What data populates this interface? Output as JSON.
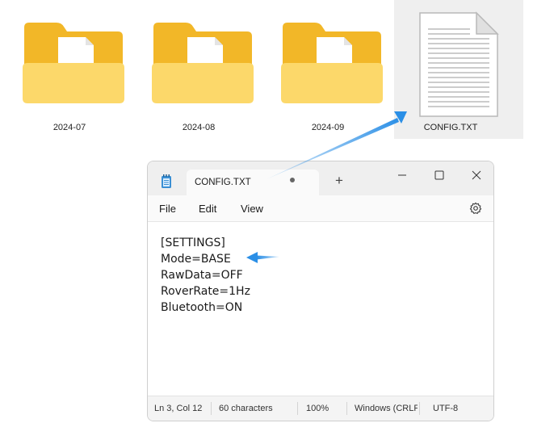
{
  "desktop": {
    "items": [
      {
        "label": "2024-07",
        "icon": "folder-icon"
      },
      {
        "label": "2024-08",
        "icon": "folder-icon"
      },
      {
        "label": "2024-09",
        "icon": "folder-icon"
      },
      {
        "label": "CONFIG.TXT",
        "icon": "text-file-icon",
        "selected": true
      }
    ]
  },
  "notepad": {
    "tab_title": "CONFIG.TXT",
    "new_tab_label": "+",
    "menu": {
      "file": "File",
      "edit": "Edit",
      "view": "View"
    },
    "lines": [
      "[SETTINGS]",
      "Mode=BASE",
      "RawData=OFF",
      "RoverRate=1Hz",
      "Bluetooth=ON"
    ],
    "status": {
      "position": "Ln 3, Col 12",
      "characters": "60 characters",
      "zoom": "100%",
      "line_ending": "Windows (CRLF)",
      "encoding": "UTF-8"
    }
  },
  "colors": {
    "arrow": "#2b8fe6",
    "folder_back": "#f2b728",
    "folder_front": "#fcd86a",
    "window_border": "#cfcfcf",
    "selection": "#efefef"
  }
}
